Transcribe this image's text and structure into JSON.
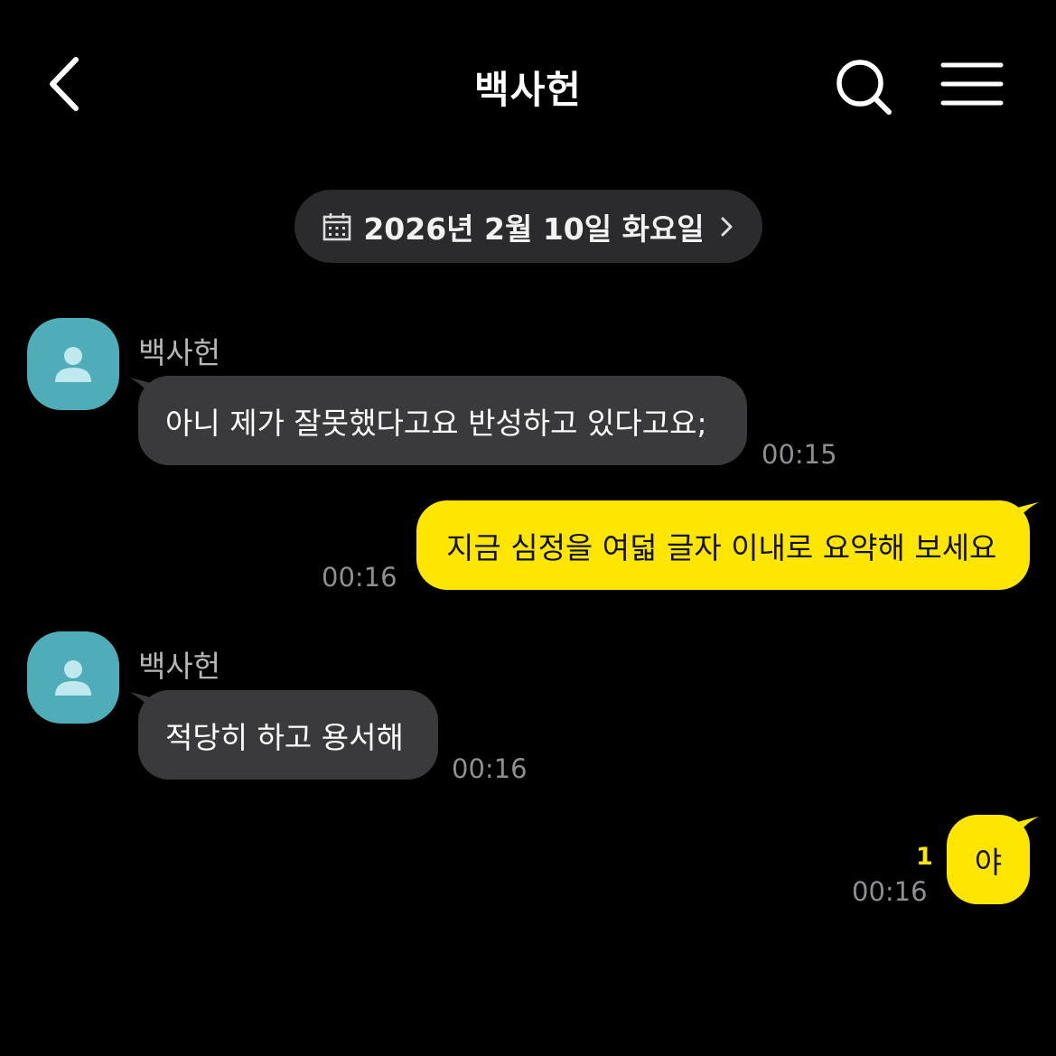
{
  "header": {
    "title": "백사헌"
  },
  "date_divider": {
    "label": "2026년 2월 10일 화요일"
  },
  "messages": [
    {
      "direction": "in",
      "sender": "백사헌",
      "text": "아니 제가 잘못했다고요 반성하고 있다고요;",
      "time": "00:15"
    },
    {
      "direction": "out",
      "text": "지금 심정을 여덟 글자 이내로 요약해 보세요",
      "time": "00:16"
    },
    {
      "direction": "in",
      "sender": "백사헌",
      "text": "적당히 하고 용서해",
      "time": "00:16"
    },
    {
      "direction": "out",
      "text": "야",
      "time": "00:16",
      "unread_count": "1"
    }
  ],
  "colors": {
    "background": "#000000",
    "incoming_bubble": "#3a3a3c",
    "outgoing_bubble": "#ffe600",
    "avatar": "#4fadba",
    "unread": "#ffe600"
  },
  "icons": [
    "back-arrow-icon",
    "search-icon",
    "menu-icon",
    "calendar-icon",
    "chevron-right-icon",
    "person-icon"
  ]
}
